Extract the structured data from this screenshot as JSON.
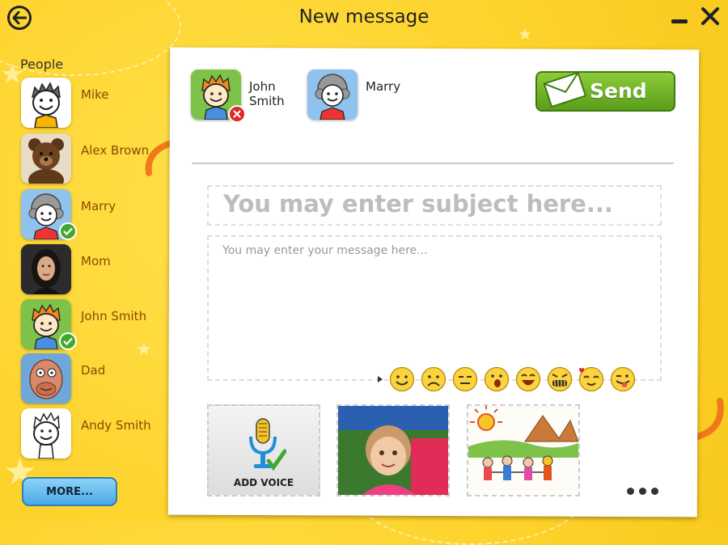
{
  "header": {
    "title": "New message"
  },
  "sidebar": {
    "heading": "People",
    "people": [
      {
        "name": "Mike",
        "verified": false
      },
      {
        "name": "Alex Brown",
        "verified": false
      },
      {
        "name": "Marry",
        "verified": true
      },
      {
        "name": "Mom",
        "verified": false
      },
      {
        "name": "John Smith",
        "verified": true
      },
      {
        "name": "Dad",
        "verified": false
      },
      {
        "name": "Andy Smith",
        "verified": false
      }
    ],
    "more_label": "MORE..."
  },
  "compose": {
    "recipients": [
      {
        "name": "John Smith"
      },
      {
        "name": "Marry"
      }
    ],
    "send_label": "Send",
    "subject_placeholder": "You may enter subject here...",
    "message_placeholder": "You may enter your message here...",
    "emojis": [
      "smile",
      "sad",
      "neutral",
      "surprised",
      "laugh",
      "grimace",
      "in-love",
      "wink-tongue"
    ],
    "attachments": {
      "voice_label": "ADD VOICE"
    }
  },
  "colors": {
    "background": "#fdd22a",
    "send": "#6fb425",
    "accent_orange": "#f07a1a",
    "name_text": "#8a4a00"
  }
}
